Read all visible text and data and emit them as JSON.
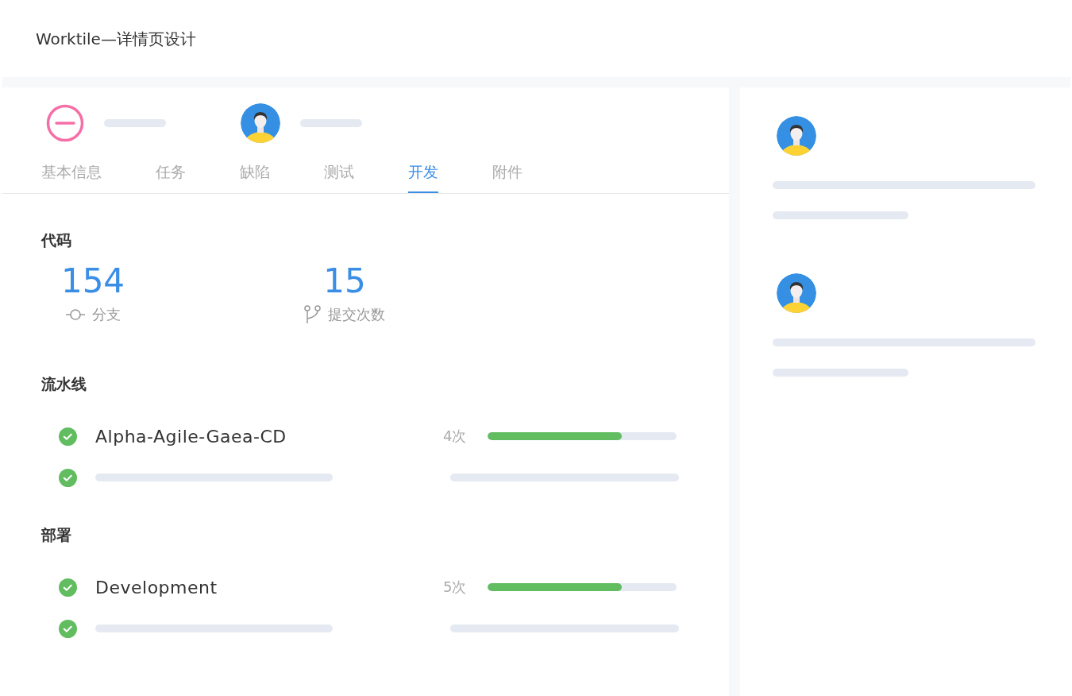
{
  "page_title": "Worktile—详情页设计",
  "tabs": [
    {
      "label": "基本信息",
      "selected": false
    },
    {
      "label": "任务",
      "selected": false
    },
    {
      "label": "缺陷",
      "selected": false
    },
    {
      "label": "测试",
      "selected": false
    },
    {
      "label": "开发",
      "selected": true
    },
    {
      "label": "附件",
      "selected": false
    }
  ],
  "sections": [
    {
      "kind": "stats",
      "title": "代码",
      "stats": [
        {
          "value": "154",
          "label": "分支"
        },
        {
          "value": "15",
          "label": "提交次数"
        }
      ]
    },
    {
      "kind": "list",
      "title": "流水线",
      "rows": [
        {
          "kind": "item",
          "passed": true,
          "name": "Alpha-Agile-Gaea-CD",
          "count": "4次",
          "level": 0.71
        },
        {
          "kind": "placeholder",
          "passed": true
        }
      ]
    },
    {
      "kind": "list",
      "title": "部署",
      "rows": [
        {
          "kind": "item",
          "passed": true,
          "name": "Development",
          "count": "5次",
          "level": 0.71
        },
        {
          "kind": "placeholder",
          "passed": true
        }
      ]
    }
  ],
  "comments": [
    {
      "kind": "placeholder"
    },
    {
      "kind": "placeholder"
    }
  ]
}
